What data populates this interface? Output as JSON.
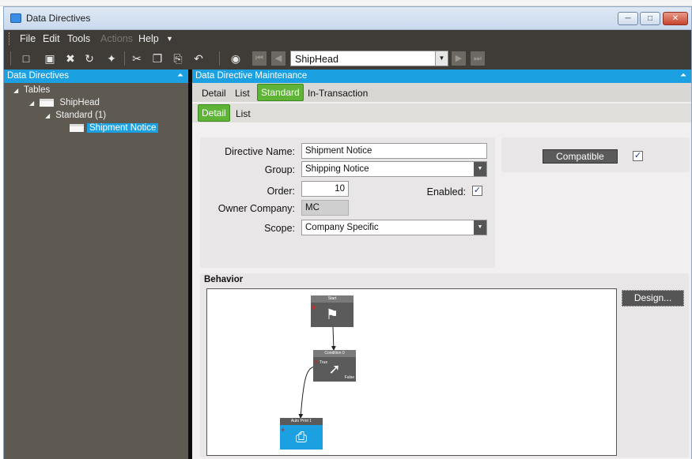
{
  "window": {
    "title": "Data Directives"
  },
  "menu": {
    "items": [
      {
        "label": "File",
        "enabled": true
      },
      {
        "label": "Edit",
        "enabled": true
      },
      {
        "label": "Tools",
        "enabled": true
      },
      {
        "label": "Actions",
        "enabled": false
      },
      {
        "label": "Help",
        "enabled": true
      }
    ]
  },
  "toolbar": {
    "table_combo_value": "ShipHead",
    "icons": [
      "new-icon",
      "save-icon",
      "delete-icon",
      "refresh-icon",
      "clear-icon",
      "cut-icon",
      "copy-icon",
      "paste-icon",
      "undo-icon",
      "search-icon",
      "first-record-icon",
      "previous-record-icon",
      "next-record-icon",
      "last-record-icon"
    ]
  },
  "left_panel": {
    "title": "Data Directives",
    "tree": [
      {
        "label": "Tables",
        "level": 0
      },
      {
        "label": "ShipHead",
        "level": 1
      },
      {
        "label": "Standard (1)",
        "level": 2
      },
      {
        "label": "Shipment Notice",
        "level": 3,
        "selected": true
      }
    ]
  },
  "right_panel": {
    "title": "Data Directive Maintenance",
    "tabs": [
      "Detail",
      "List",
      "Standard",
      "In-Transaction"
    ],
    "active_tab": "Standard",
    "subtabs": [
      "Detail",
      "List"
    ],
    "active_subtab": "Detail"
  },
  "form": {
    "directive_name_label": "Directive Name:",
    "directive_name_value": "Shipment Notice",
    "group_label": "Group:",
    "group_value": "Shipping Notice",
    "order_label": "Order:",
    "order_value": "10",
    "enabled_label": "Enabled:",
    "enabled_checked": true,
    "owner_company_label": "Owner Company:",
    "owner_company_value": "MC",
    "scope_label": "Scope:",
    "scope_value": "Company Specific",
    "compatible_label": "Compatible",
    "compatible_checked": true
  },
  "behavior": {
    "header": "Behavior",
    "design_button": "Design...",
    "nodes": [
      {
        "title": "Start",
        "icon": "flag-icon"
      },
      {
        "title": "Condition 0",
        "icon": "condition-icon",
        "true_label": "True",
        "false_label": "False"
      },
      {
        "title": "Auto Print 1",
        "icon": "printer-icon"
      }
    ]
  },
  "colors": {
    "accent": "#1ba1e2",
    "active_tab": "#5fb336",
    "panel_bg": "#5e5a52",
    "toolbar_bg": "#3f3c37"
  }
}
